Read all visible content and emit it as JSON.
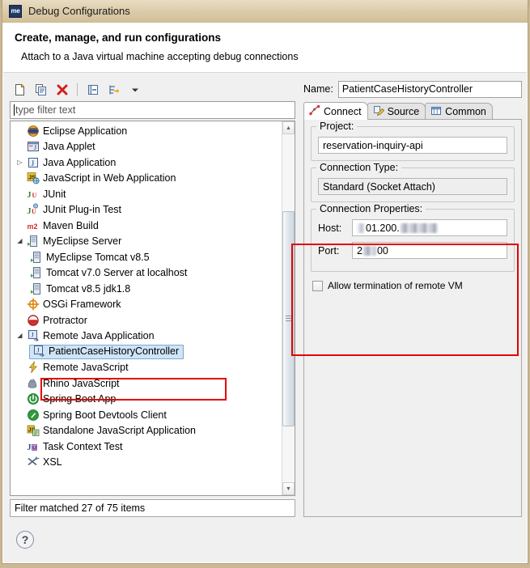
{
  "window": {
    "title": "Debug Configurations",
    "icon_label": "me",
    "icon_name": "myeclipse-icon"
  },
  "header": {
    "title": "Create, manage, and run configurations",
    "subtitle": "Attach to a Java virtual machine accepting debug connections"
  },
  "toolbar": {
    "buttons": [
      {
        "name": "new-configuration-icon",
        "tooltip": "New launch configuration"
      },
      {
        "name": "duplicate-configuration-icon",
        "tooltip": "Duplicate currently selected launch configuration"
      },
      {
        "name": "delete-configuration-icon",
        "tooltip": "Delete selected launch configuration(s)"
      },
      {
        "name": "collapse-all-icon",
        "tooltip": "Collapse All"
      },
      {
        "name": "filter-launch-configurations-icon",
        "tooltip": "Filter launch configurations"
      },
      {
        "name": "toolbar-dropdown-arrow-icon",
        "tooltip": "View Menu"
      }
    ]
  },
  "filter": {
    "placeholder": "type filter text",
    "value": ""
  },
  "tree": {
    "items": [
      {
        "label": "Eclipse Application",
        "icon": "eclipse-icon",
        "indent": 0,
        "twisty": "",
        "selected": false
      },
      {
        "label": "Java Applet",
        "icon": "java-applet-icon",
        "indent": 0,
        "twisty": "",
        "selected": false
      },
      {
        "label": "Java Application",
        "icon": "java-application-icon",
        "indent": 0,
        "twisty": "collapsed",
        "selected": false
      },
      {
        "label": "JavaScript in Web Application",
        "icon": "javascript-web-icon",
        "indent": 0,
        "twisty": "",
        "selected": false
      },
      {
        "label": "JUnit",
        "icon": "junit-icon",
        "indent": 0,
        "twisty": "",
        "selected": false
      },
      {
        "label": "JUnit Plug-in Test",
        "icon": "junit-plugin-icon",
        "indent": 0,
        "twisty": "",
        "selected": false
      },
      {
        "label": "Maven Build",
        "icon": "maven-icon",
        "indent": 0,
        "twisty": "",
        "selected": false
      },
      {
        "label": "MyEclipse Server",
        "icon": "server-icon",
        "indent": 0,
        "twisty": "expanded",
        "selected": false
      },
      {
        "label": "MyEclipse Tomcat v8.5",
        "icon": "server-icon",
        "indent": 1,
        "twisty": "",
        "selected": false
      },
      {
        "label": "Tomcat v7.0 Server at localhost",
        "icon": "server-icon",
        "indent": 1,
        "twisty": "",
        "selected": false
      },
      {
        "label": "Tomcat v8.5 jdk1.8",
        "icon": "server-icon",
        "indent": 1,
        "twisty": "",
        "selected": false
      },
      {
        "label": "OSGi Framework",
        "icon": "osgi-icon",
        "indent": 0,
        "twisty": "",
        "selected": false
      },
      {
        "label": "Protractor",
        "icon": "protractor-icon",
        "indent": 0,
        "twisty": "",
        "selected": false
      },
      {
        "label": "Remote Java Application",
        "icon": "remote-java-icon",
        "indent": 0,
        "twisty": "expanded",
        "selected": false
      },
      {
        "label": "PatientCaseHistoryController",
        "icon": "remote-java-icon",
        "indent": 1,
        "twisty": "",
        "selected": true
      },
      {
        "label": "Remote JavaScript",
        "icon": "remote-javascript-icon",
        "indent": 0,
        "twisty": "",
        "selected": false
      },
      {
        "label": "Rhino JavaScript",
        "icon": "rhino-icon",
        "indent": 0,
        "twisty": "",
        "selected": false
      },
      {
        "label": "Spring Boot App",
        "icon": "spring-boot-icon",
        "indent": 0,
        "twisty": "",
        "selected": false
      },
      {
        "label": "Spring Boot Devtools Client",
        "icon": "spring-devtools-icon",
        "indent": 0,
        "twisty": "",
        "selected": false
      },
      {
        "label": "Standalone JavaScript Application",
        "icon": "standalone-javascript-icon",
        "indent": 0,
        "twisty": "",
        "selected": false
      },
      {
        "label": "Task Context Test",
        "icon": "task-context-icon",
        "indent": 0,
        "twisty": "",
        "selected": false
      },
      {
        "label": "XSL",
        "icon": "xsl-icon",
        "indent": 0,
        "twisty": "",
        "selected": false
      }
    ]
  },
  "status": {
    "text": "Filter matched 27 of 75 items"
  },
  "details": {
    "name_label": "Name:",
    "name_value": "PatientCaseHistoryController",
    "tabs": [
      {
        "label": "Connect",
        "icon": "connect-icon",
        "active": true
      },
      {
        "label": "Source",
        "icon": "source-pencil-icon",
        "active": false
      },
      {
        "label": "Common",
        "icon": "common-table-icon",
        "active": false
      }
    ],
    "project": {
      "group_label": "Project:",
      "value": "reservation-inquiry-api"
    },
    "connection_type": {
      "group_label": "Connection Type:",
      "value": "Standard (Socket Attach)"
    },
    "connection_properties": {
      "group_label": "Connection Properties:",
      "host_label": "Host:",
      "host_value": "01.200.",
      "host_redacted": true,
      "port_label": "Port:",
      "port_value_prefix": "2",
      "port_value_suffix": "00",
      "port_redacted": true
    },
    "allow_termination": {
      "label": "Allow termination of remote VM",
      "checked": false
    }
  },
  "bottom": {
    "help_label": "?"
  },
  "annotations": {
    "colors": {
      "highlight": "#e40000",
      "selection": "#cfe4f7"
    },
    "boxes": [
      {
        "name": "selected-config-annotation",
        "target": "PatientCaseHistoryController"
      },
      {
        "name": "connection-properties-annotation",
        "target": "Connection Properties"
      }
    ]
  }
}
